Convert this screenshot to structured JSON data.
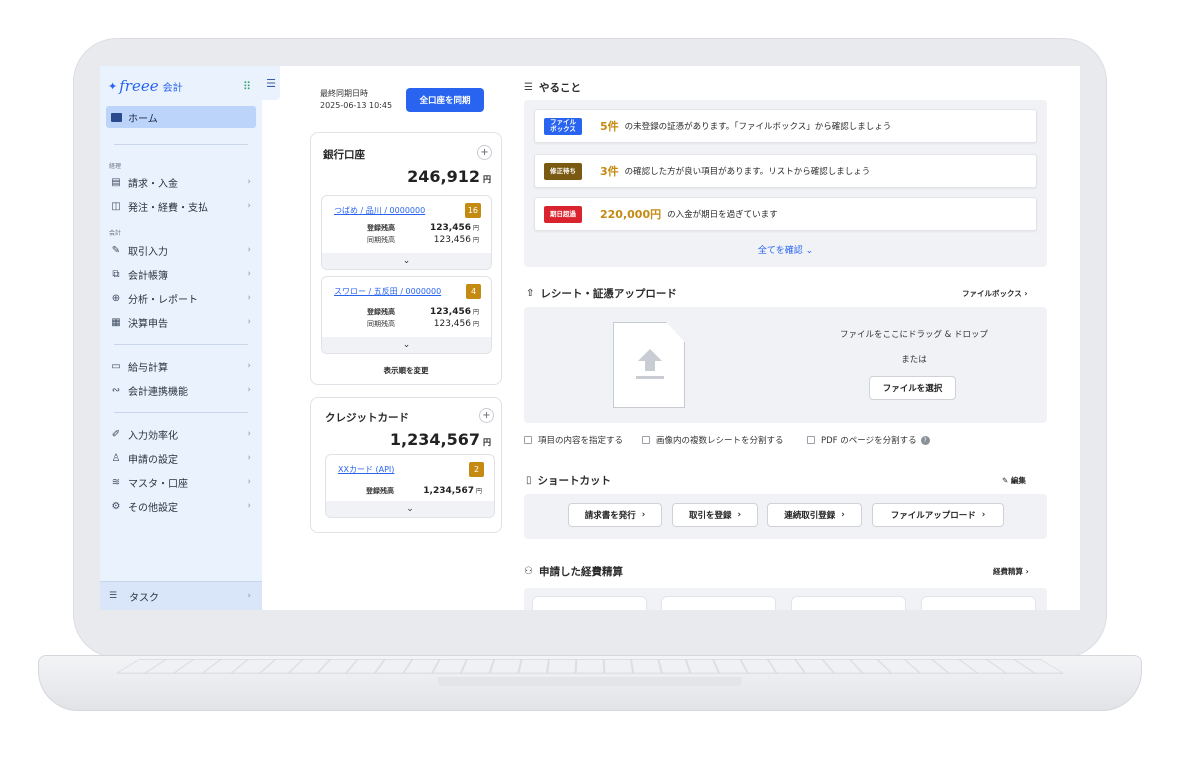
{
  "sidebar": {
    "logo_mark": "freee",
    "logo_text": "会計",
    "grid_glyph": "⠿",
    "collapse_glyph": "☰",
    "home_label": "ホーム",
    "sections": {
      "keiri": "経理",
      "kaikei": "会計"
    },
    "items": [
      {
        "label": "請求・入金",
        "icon": "invoice-icon"
      },
      {
        "label": "発注・経費・支払",
        "icon": "wallet-icon"
      },
      {
        "label": "取引入力",
        "icon": "pen-icon"
      },
      {
        "label": "会計帳簿",
        "icon": "book-icon"
      },
      {
        "label": "分析・レポート",
        "icon": "magnify-icon"
      },
      {
        "label": "決算申告",
        "icon": "report-icon"
      },
      {
        "label": "給与計算",
        "icon": "card-icon"
      },
      {
        "label": "会計連携機能",
        "icon": "link-icon"
      },
      {
        "label": "入力効率化",
        "icon": "pen-spark-icon"
      },
      {
        "label": "申請の設定",
        "icon": "stamp-icon"
      },
      {
        "label": "マスタ・口座",
        "icon": "database-icon"
      },
      {
        "label": "その他設定",
        "icon": "gear-icon"
      }
    ],
    "task_label": "タスク"
  },
  "sync": {
    "label": "最終同期日時",
    "datetime": "2025-06-13 10:45",
    "button": "全口座を同期"
  },
  "bank": {
    "title": "銀行口座",
    "total": "246,912",
    "yen": "円",
    "accounts": [
      {
        "name": "つばめ / 品川 / 0000000",
        "badge": "16",
        "registered_label": "登録残高",
        "registered": "123,456",
        "synced_label": "同期残高",
        "synced": "123,456"
      },
      {
        "name": "スワロー / 五反田 / 0000000",
        "badge": "4",
        "registered_label": "登録残高",
        "registered": "123,456",
        "synced_label": "同期残高",
        "synced": "123,456"
      }
    ],
    "reorder": "表示順を変更"
  },
  "credit": {
    "title": "クレジットカード",
    "total": "1,234,567",
    "yen": "円",
    "account": {
      "name": "XXカード (API)",
      "badge": "2",
      "registered_label": "登録残高",
      "registered": "1,234,567"
    }
  },
  "todo": {
    "title": "やること",
    "items": [
      {
        "tag": "ファイル\nボックス",
        "tag_color": "#2864f0",
        "count": "5件",
        "desc": "の未登録の証憑があります。「ファイルボックス」から確認しましょう"
      },
      {
        "tag": "修正待ち",
        "tag_color": "#7a5a12",
        "count": "3件",
        "desc": "の確認した方が良い項目があります。リストから確認しましょう"
      },
      {
        "tag": "期日超過",
        "tag_color": "#d9232e",
        "count": "220,000円",
        "desc": "の入金が期日を過ぎています"
      }
    ],
    "see_all": "全てを確認"
  },
  "upload": {
    "title": "レシート・証憑アップロード",
    "link": "ファイルボックス",
    "drop_text": "ファイルをここにドラッグ & ドロップ",
    "or_text": "または",
    "select_button": "ファイルを選択",
    "options": [
      "項目の内容を指定する",
      "画像内の複数レシートを分割する",
      "PDF のページを分割する"
    ]
  },
  "shortcuts": {
    "title": "ショートカット",
    "edit": "編集",
    "buttons": [
      "請求書を発行",
      "取引を登録",
      "連続取引登録",
      "ファイルアップロード"
    ]
  },
  "expenses": {
    "title": "申請した経費精算",
    "link": "経費精算"
  }
}
